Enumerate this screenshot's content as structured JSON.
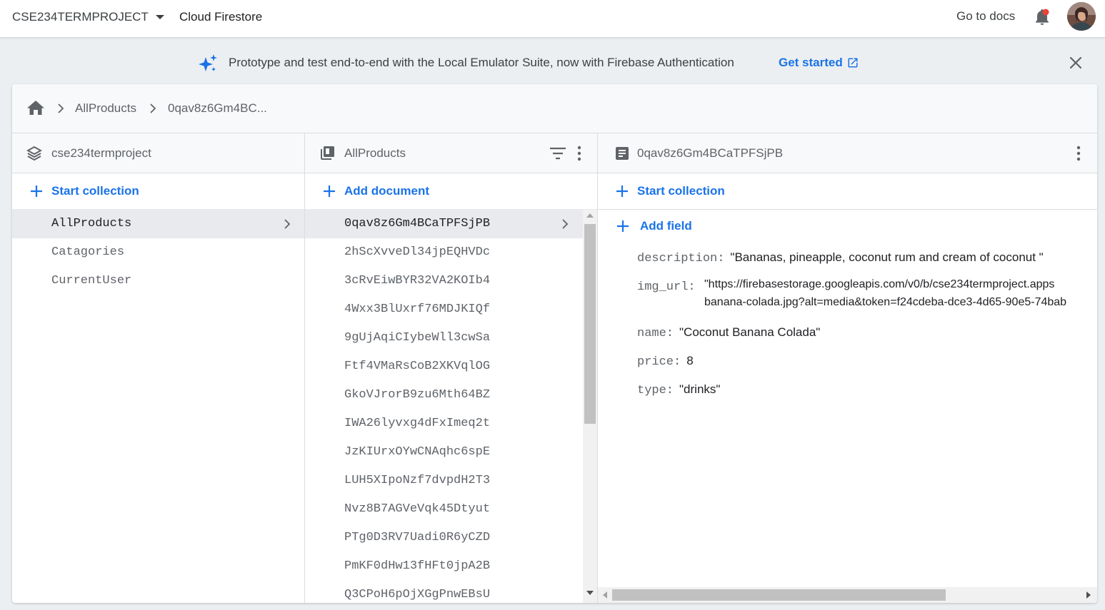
{
  "header": {
    "project": "CSE234TERMPROJECT",
    "product": "Cloud Firestore",
    "docs_link": "Go to docs"
  },
  "banner": {
    "text": "Prototype and test end-to-end with the Local Emulator Suite, now with Firebase Authentication",
    "link": "Get started"
  },
  "breadcrumb": {
    "items": [
      "AllProducts",
      "0qav8z6Gm4BC..."
    ]
  },
  "root_panel": {
    "title": "cse234termproject",
    "action": "Start collection",
    "items": [
      "AllProducts",
      "Catagories",
      "CurrentUser"
    ]
  },
  "collection_panel": {
    "title": "AllProducts",
    "action": "Add document",
    "items": [
      "0qav8z6Gm4BCaTPFSjPB",
      "2hScXvveDl34jpEQHVDc",
      "3cRvEiwBYR32VA2KOIb4",
      "4Wxx3BlUxrf76MDJKIQf",
      "9gUjAqiCIybeWll3cwSa",
      "Ftf4VMaRsCoB2XKVqlOG",
      "GkoVJrorB9zu6Mth64BZ",
      "IWA26lyvxg4dFxImeq2t",
      "JzKIUrxOYwCNAqhc6spE",
      "LUH5XIpoNzf7dvpdH2T3",
      "Nvz8B7AGVeVqk45Dtyut",
      "PTg0D3RV7Uadi0R6yCZD",
      "PmKF0dHw13fHFt0jpA2B",
      "Q3CPoH6pOjXGgPnwEBsU"
    ]
  },
  "document_panel": {
    "title": "0qav8z6Gm4BCaTPFSjPB",
    "action": "Start collection",
    "add_field": "Add field",
    "fields": {
      "description_key": "description:",
      "description_value": "\"Bananas, pineapple, coconut rum and cream of coconut \"",
      "img_url_key": "img_url:",
      "img_url_line1": "\"https://firebasestorage.googleapis.com/v0/b/cse234termproject.apps",
      "img_url_line2": "banana-colada.jpg?alt=media&token=f24cdeba-dce3-4d65-90e5-74bab",
      "name_key": "name:",
      "name_value": "\"Coconut Banana Colada\"",
      "price_key": "price:",
      "price_value": "8",
      "type_key": "type:",
      "type_value": "\"drinks\""
    }
  },
  "colors": {
    "accent": "#1a73e8",
    "selected_row": "#e8eaed",
    "notification_dot": "#ea4335"
  }
}
